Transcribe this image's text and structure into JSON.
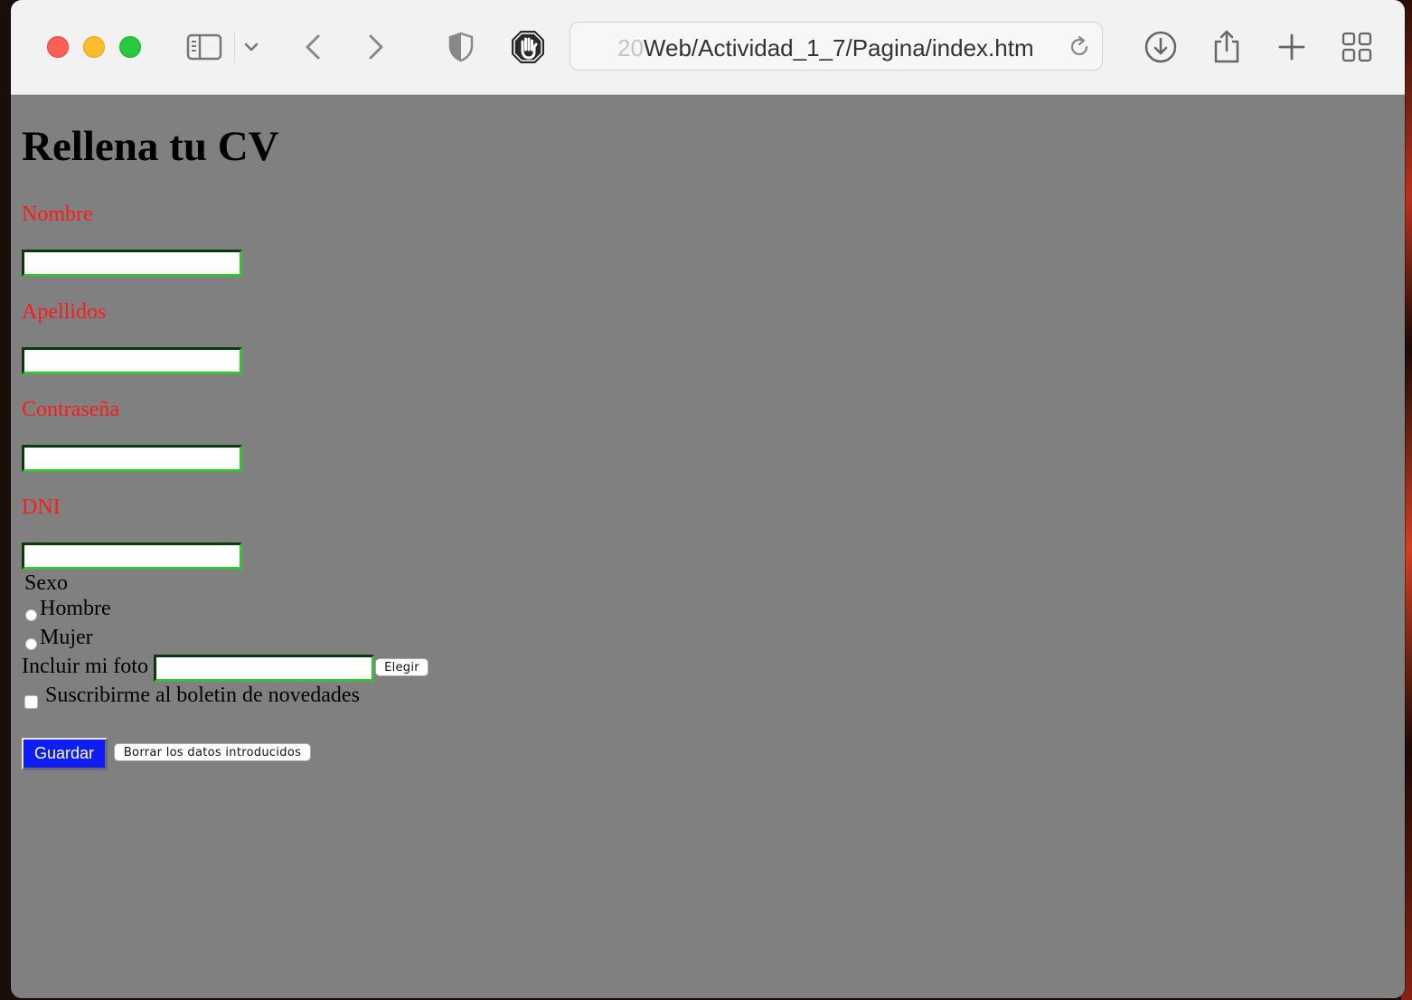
{
  "browser": {
    "address_prefix": "20",
    "address_main": "Web/Actividad_1_7/Pagina/index.htm",
    "icons": [
      "sidebar-icon",
      "chevron-down-icon",
      "back-icon",
      "forward-icon",
      "shield-icon",
      "hand-stop-icon",
      "reload-icon",
      "download-icon",
      "share-icon",
      "plus-icon",
      "tabs-grid-icon"
    ]
  },
  "page": {
    "title": "Rellena tu CV",
    "fields": {
      "nombre_label": "Nombre",
      "apellidos_label": "Apellidos",
      "contrasena_label": "Contraseña",
      "dni_label": "DNI",
      "nombre_value": "",
      "apellidos_value": "",
      "contrasena_value": "",
      "dni_value": ""
    },
    "sexo": {
      "legend": "Sexo",
      "option_hombre": "Hombre",
      "option_mujer": "Mujer"
    },
    "foto": {
      "label": "Incluir mi foto",
      "button": "Elegir"
    },
    "boletin": {
      "label": "Suscribirme al boletin de novedades",
      "checked": false
    },
    "actions": {
      "save": "Guardar",
      "reset": "Borrar los datos introducidos"
    }
  },
  "colors": {
    "page_background": "#808080",
    "label_color": "#ff1a1a",
    "save_button": "#0e1cf5",
    "field_border": "#36c236"
  }
}
